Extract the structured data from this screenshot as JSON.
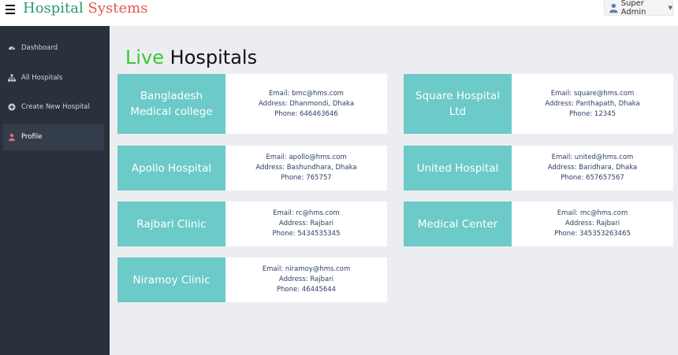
{
  "header": {
    "brand_part1": "Hospital",
    "brand_part2": "Systems",
    "user_name": "Super Admin"
  },
  "sidebar": {
    "items": [
      {
        "label": "Dashboard",
        "icon": "dashboard-icon"
      },
      {
        "label": "All Hospitals",
        "icon": "sitemap-icon"
      },
      {
        "label": "Create New Hospital",
        "icon": "plus-circle-icon"
      },
      {
        "label": "Profile",
        "icon": "user-icon"
      }
    ]
  },
  "main": {
    "title_highlight": "Live",
    "title_rest": "Hospitals",
    "hospitals": [
      {
        "name": "Bangladesh Medical college",
        "email": "Email: bmc@hms.com",
        "address": "Address: Dhanmondi, Dhaka",
        "phone": "Phone: 646463646"
      },
      {
        "name": "Square Hospital Ltd",
        "email": "Email: square@hms.com",
        "address": "Address: Panthapath, Dhaka",
        "phone": "Phone: 12345"
      },
      {
        "name": "Apollo Hospital",
        "email": "Email: apollo@hms.com",
        "address": "Address: Bashundhara, Dhaka",
        "phone": "Phone: 765757"
      },
      {
        "name": "United Hospital",
        "email": "Email: united@hms.com",
        "address": "Address: Baridhara, Dhaka",
        "phone": "Phone: 657657567"
      },
      {
        "name": "Rajbari Clinic",
        "email": "Email: rc@hms.com",
        "address": "Address: Rajbari",
        "phone": "Phone: 5434535345"
      },
      {
        "name": "Medical Center",
        "email": "Email: mc@hms.com",
        "address": "Address: Rajbari",
        "phone": "Phone: 345353263465"
      },
      {
        "name": "Niramoy Clinic",
        "email": "Email: niramoy@hms.com",
        "address": "Address: Rajbari",
        "phone": "Phone: 46445644"
      }
    ]
  },
  "colors": {
    "card_accent": "#6ccac8",
    "sidebar_bg": "#28313c",
    "title_live": "#33cc33",
    "brand_hospital": "#2a9b6e",
    "brand_systems": "#e05a4e"
  }
}
